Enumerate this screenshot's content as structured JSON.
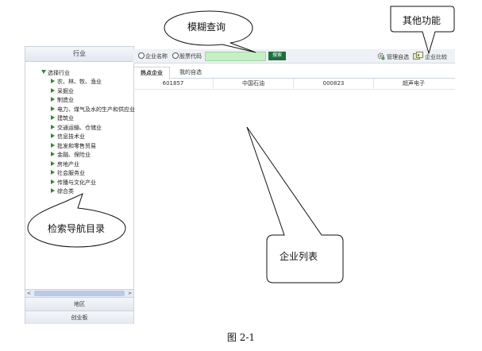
{
  "left_panel": {
    "header": "行业",
    "tree_root": "选择行业",
    "industries": [
      "农、林、牧、渔业",
      "采掘业",
      "制造业",
      "电力、煤气及水的生产和供应业",
      "建筑业",
      "交通运输、仓储业",
      "信息技术业",
      "批发和零售贸易",
      "金融、保险业",
      "房地产业",
      "社会服务业",
      "传播与文化产业",
      "综合类"
    ],
    "scroll_left": "<",
    "scroll_right": ">",
    "footer_1": "地区",
    "footer_2": "创业板"
  },
  "search_bar": {
    "radio_company_name": "企业名称",
    "radio_stock_code": "股票代码",
    "search_value": "",
    "search_button": "搜索"
  },
  "tools": {
    "manage": "管理自选",
    "compare": "企业比较"
  },
  "tabs": [
    "热点企业",
    "我的自选"
  ],
  "table_rows": [
    {
      "code_1": "601857",
      "name_1": "中国石油",
      "code_2": "000823",
      "name_2": "超声电子"
    }
  ],
  "callouts": {
    "fuzzy_search": "模糊查询",
    "other_functions": "其他功能",
    "nav_directory": "检索导航目录",
    "company_list": "企业列表"
  },
  "figure_caption": "图 2-1",
  "colors": {
    "accent_green": "#1f6f3a",
    "search_input_green": "#c7efc6",
    "tree_arrow_green": "#2c8a2c",
    "panel_border": "#c9d3df"
  }
}
